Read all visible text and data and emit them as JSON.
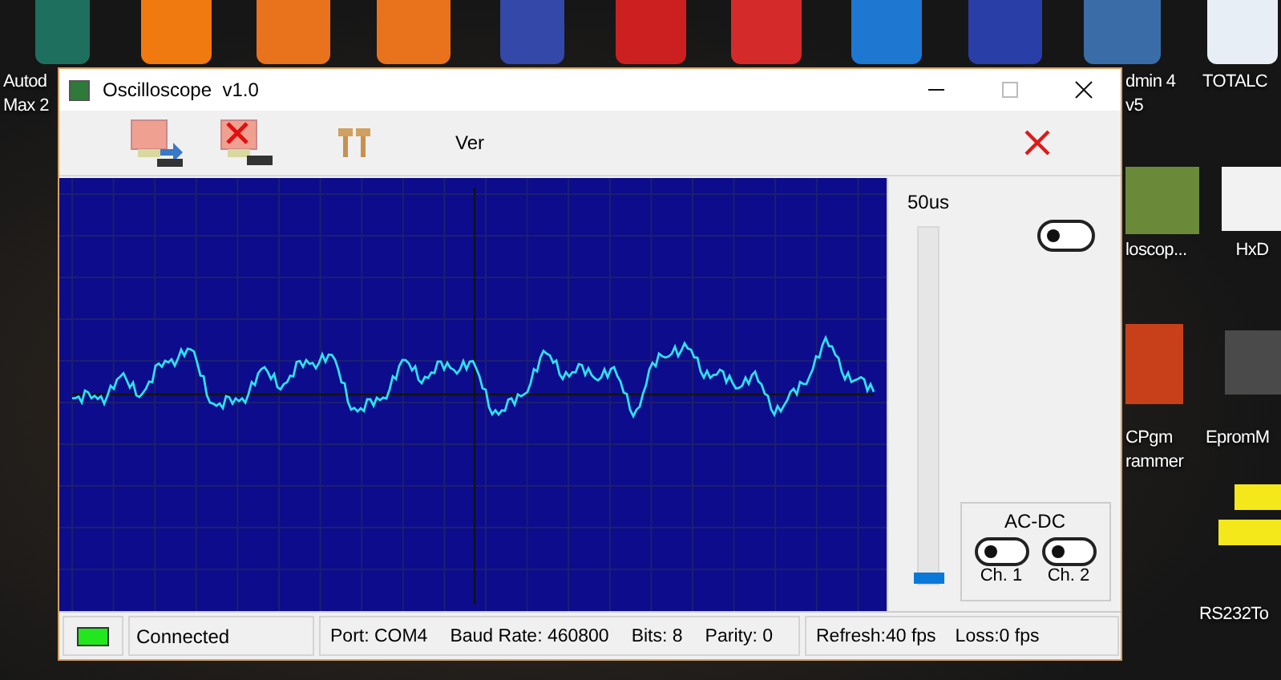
{
  "desktop": {
    "icons": [
      {
        "lines": [
          "Autod",
          "Max 2"
        ]
      },
      {
        "lines": [
          "dmin 4",
          "v5"
        ]
      },
      {
        "lines": [
          "TOTALC"
        ]
      },
      {
        "lines": [
          "loscop..."
        ]
      },
      {
        "lines": [
          "HxD"
        ]
      },
      {
        "lines": [
          "CPgm",
          "rammer"
        ]
      },
      {
        "lines": [
          "EpromM"
        ]
      },
      {
        "lines": [
          "RS232To"
        ]
      }
    ]
  },
  "window": {
    "title": "Oscilloscope  v1.0"
  },
  "toolbar": [
    {
      "kind": "connect"
    },
    {
      "kind": "disconnect"
    },
    {
      "kind": "tools"
    },
    {
      "kind": "text",
      "label": "Ver"
    },
    {
      "kind": "exit"
    }
  ],
  "controls": {
    "timebase": "50us",
    "slider": {
      "level": 0.0
    },
    "trigger": {
      "on": false
    },
    "ac_dc": {
      "title": "AC-DC",
      "channels": [
        {
          "label": "Ch. 1",
          "on": false
        },
        {
          "label": "Ch. 2",
          "on": false
        }
      ]
    }
  },
  "status_bar": {
    "indicator": {
      "color": "#22e61e"
    },
    "connection": "Connected",
    "port_info": [
      "Port: COM4",
      "Baud Rate: 460800",
      "Bits: 8",
      "Parity: 0"
    ],
    "rates": [
      "Refresh:40 fps",
      "Loss:0 fps"
    ]
  }
}
